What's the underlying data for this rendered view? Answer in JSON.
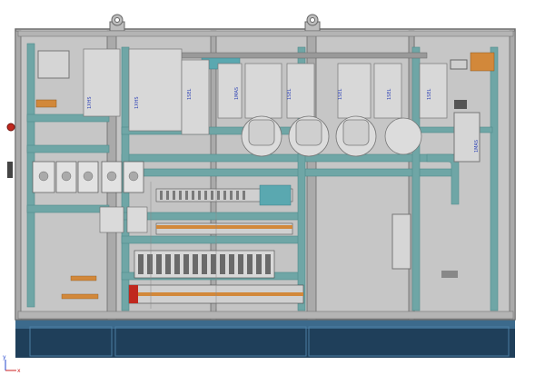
{
  "viewport": {
    "background": "#ffffff",
    "colors": {
      "cabinet_frame": "#9a9a9a",
      "panel_gray": "#c9c9c9",
      "duct_teal": "#6fa6a6",
      "base_navy": "#1f3f5a",
      "label_blue": "#2a3fb5",
      "terminal_orange": "#d2883a",
      "red_button": "#c0281e"
    }
  },
  "component_labels": [
    {
      "id": "l1",
      "text": "1XHS"
    },
    {
      "id": "l2",
      "text": "1XHS"
    },
    {
      "id": "l3",
      "text": "1SEL"
    },
    {
      "id": "l4",
      "text": "1SEL"
    },
    {
      "id": "l5",
      "text": "1SEL"
    },
    {
      "id": "l6",
      "text": "1SEL"
    },
    {
      "id": "l7",
      "text": "1SEL"
    },
    {
      "id": "l8",
      "text": "1MAS"
    },
    {
      "id": "l9",
      "text": "1MAS"
    }
  ],
  "axis_triad": {
    "x_label": "x",
    "y_label": "y",
    "x_color": "#cc2222",
    "y_color": "#2244cc"
  }
}
